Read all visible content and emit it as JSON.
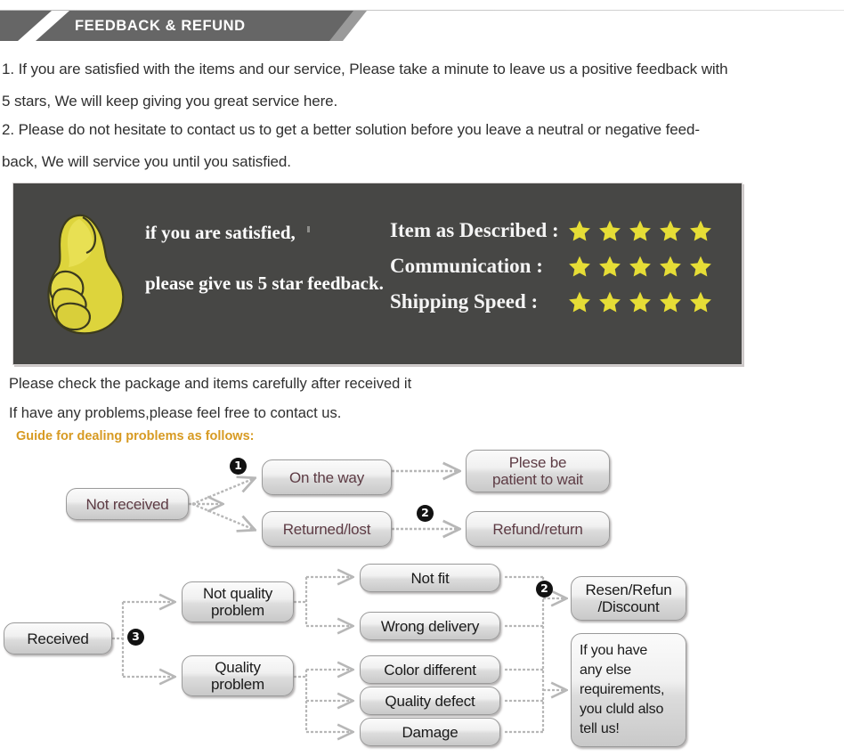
{
  "header": {
    "title": "FEEDBACK & REFUND",
    "bar_color": "#666666",
    "tip_color": "#9a9a9a"
  },
  "intro": {
    "item1_line1": "1. If you are satisfied with the items and our service, Please take a minute to leave us a positive feedback with",
    "item1_line2": "5 stars, We will keep giving you great service here.",
    "item2_line1": "2. Please do not hesitate to contact us to get a better solution before you leave a neutral or negative feed-",
    "item2_line2": "back, We will service you until you satisfied."
  },
  "panel": {
    "background": "#474745",
    "star_color": "#e6dd36",
    "thumb_color": "#e3d83f",
    "satisfied_line": "if you are satisfied,",
    "feedback_line": "please give us 5 star feedback.",
    "ratings": [
      {
        "label": "Item as Described :",
        "stars": 5
      },
      {
        "label": "Communication :",
        "stars": 5
      },
      {
        "label": "Shipping Speed :",
        "stars": 5
      }
    ]
  },
  "notes": {
    "check_package": "Please check the package and items carefully after received it",
    "contact_us": "If have any problems,please feel free to contact us.",
    "guide_title": "Guide for dealing problems as follows:",
    "guide_title_color": "#d79a22"
  },
  "flow_not_received": {
    "start": "Not received",
    "badge1": "❶",
    "badge2": "❷",
    "branch_top": "On the way",
    "branch_bottom": "Returned/lost",
    "result_top_line1": "Plese be",
    "result_top_line2": "patient to wait",
    "result_bottom": "Refund/return"
  },
  "flow_received": {
    "start": "Received",
    "badge3": "❸",
    "badge2": "❷",
    "cat_top_line1": "Not quality",
    "cat_top_line2": "problem",
    "cat_bottom_line1": "Quality",
    "cat_bottom_line2": "problem",
    "issues": [
      "Not fit",
      "Wrong delivery",
      "Color different",
      "Quality defect",
      "Damage"
    ],
    "outcome_top_line1": "Resen/Refun",
    "outcome_top_line2": "/Discount",
    "outcome_bottom_lines": [
      "If you have",
      "any else",
      "requirements,",
      "you cluld also",
      "tell us!"
    ]
  }
}
